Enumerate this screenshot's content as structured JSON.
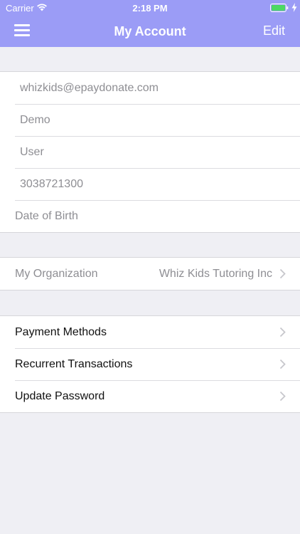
{
  "status_bar": {
    "carrier": "Carrier",
    "time": "2:18 PM",
    "battery_color": "#4cd964"
  },
  "navbar": {
    "title": "My Account",
    "edit_label": "Edit",
    "background": "#9b9cf6"
  },
  "profile": {
    "email": "whizkids@epaydonate.com",
    "first_name": "Demo",
    "last_name": "User",
    "phone": "3038721300",
    "dob_placeholder": "Date of Birth"
  },
  "organization": {
    "label": "My Organization",
    "value": "Whiz Kids Tutoring Inc"
  },
  "menu": {
    "items": [
      {
        "label": "Payment Methods"
      },
      {
        "label": "Recurrent Transactions"
      },
      {
        "label": "Update Password"
      }
    ]
  }
}
